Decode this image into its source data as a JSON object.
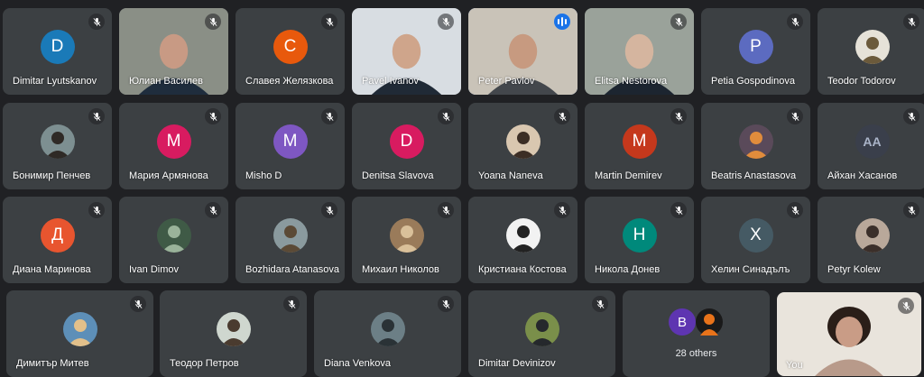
{
  "rows": [
    [
      {
        "name": "Dimitar Lyutskanov",
        "initial": "D",
        "color": "#1a7ab8",
        "kind": "initial"
      },
      {
        "name": "Юлиан Василев",
        "kind": "video",
        "bg": "#8a8f86",
        "skin": "#c89a84",
        "shirt": "#1f2d3d"
      },
      {
        "name": "Славея Желязкова",
        "initial": "C",
        "color": "#e8590c",
        "kind": "initial"
      },
      {
        "name": "Pavel Ivanov",
        "kind": "video",
        "bg": "#d8dde2",
        "skin": "#cfa58b",
        "shirt": "#202a36"
      },
      {
        "name": "Peter Pavlov",
        "kind": "video",
        "bg": "#c9c3b8",
        "skin": "#c79a80",
        "shirt": "#43474c",
        "speaking": true
      },
      {
        "name": "Elitsa Nestorova",
        "kind": "video",
        "bg": "#9aa29a",
        "skin": "#d5b59f",
        "shirt": "#1c2530"
      },
      {
        "name": "Petia Gospodinova",
        "initial": "P",
        "color": "#5c6bc0",
        "kind": "initial"
      },
      {
        "name": "Teodor Todorov",
        "kind": "photo",
        "pbg": "#e6e2d8",
        "pfg": "#6b5a3b"
      }
    ],
    [
      {
        "name": "Бонимир Пенчев",
        "kind": "photo",
        "pbg": "#7d8f91",
        "pfg": "#2f2a26"
      },
      {
        "name": "Мария Армянова",
        "initial": "M",
        "color": "#d81b60",
        "kind": "initial"
      },
      {
        "name": "Misho D",
        "initial": "M",
        "color": "#7e57c2",
        "kind": "initial"
      },
      {
        "name": "Denitsa Slavova",
        "initial": "D",
        "color": "#d81b60",
        "kind": "initial"
      },
      {
        "name": "Yoana Naneva",
        "kind": "photo",
        "pbg": "#d9c7b0",
        "pfg": "#3c2e25"
      },
      {
        "name": "Martin Demirev",
        "initial": "M",
        "color": "#c5381c",
        "kind": "initial"
      },
      {
        "name": "Beatris Anastasova",
        "kind": "photo",
        "pbg": "#5a4a5a",
        "pfg": "#e08c3c"
      },
      {
        "name": "Айхан Хасанов",
        "kind": "logo",
        "pbg": "#3a3f4b",
        "pfg": "#aab4c8",
        "text": "AA"
      }
    ],
    [
      {
        "name": "Диана Маринова",
        "initial": "Д",
        "color": "#e8552f",
        "kind": "initial"
      },
      {
        "name": "Ivan Dimov",
        "kind": "photo",
        "pbg": "#3f5a46",
        "pfg": "#9ab39a"
      },
      {
        "name": "Bozhidara Atanasova",
        "kind": "photo",
        "pbg": "#8a9a9e",
        "pfg": "#5b4a36"
      },
      {
        "name": "Михаил Николов",
        "kind": "photo",
        "pbg": "#9a7b5a",
        "pfg": "#d9c09a"
      },
      {
        "name": "Кристиана Костова",
        "kind": "photo",
        "pbg": "#f2f2f2",
        "pfg": "#222222"
      },
      {
        "name": "Никола Донев",
        "initial": "H",
        "color": "#00897b",
        "kind": "initial"
      },
      {
        "name": "Хелин Синадълъ",
        "initial": "X",
        "color": "#455a64",
        "kind": "initial"
      },
      {
        "name": "Petyr Kolew",
        "kind": "photo",
        "pbg": "#b9a89a",
        "pfg": "#3b2f2a"
      }
    ]
  ],
  "bottom": [
    {
      "name": "Димитър Митев",
      "kind": "photo",
      "pbg": "#5d8fb8",
      "pfg": "#e2c08a"
    },
    {
      "name": "Теодор Петров",
      "kind": "photo",
      "pbg": "#cfd7cf",
      "pfg": "#4a3b2f"
    },
    {
      "name": "Diana Venkova",
      "kind": "photo",
      "pbg": "#6c7f86",
      "pfg": "#2a3236"
    },
    {
      "name": "Dimitar Devinizov",
      "kind": "photo",
      "pbg": "#7a8f4a",
      "pfg": "#25282c"
    }
  ],
  "others": {
    "label": "28 others",
    "initial": "B",
    "color": "#5e35b1"
  },
  "self": {
    "name": "You"
  }
}
